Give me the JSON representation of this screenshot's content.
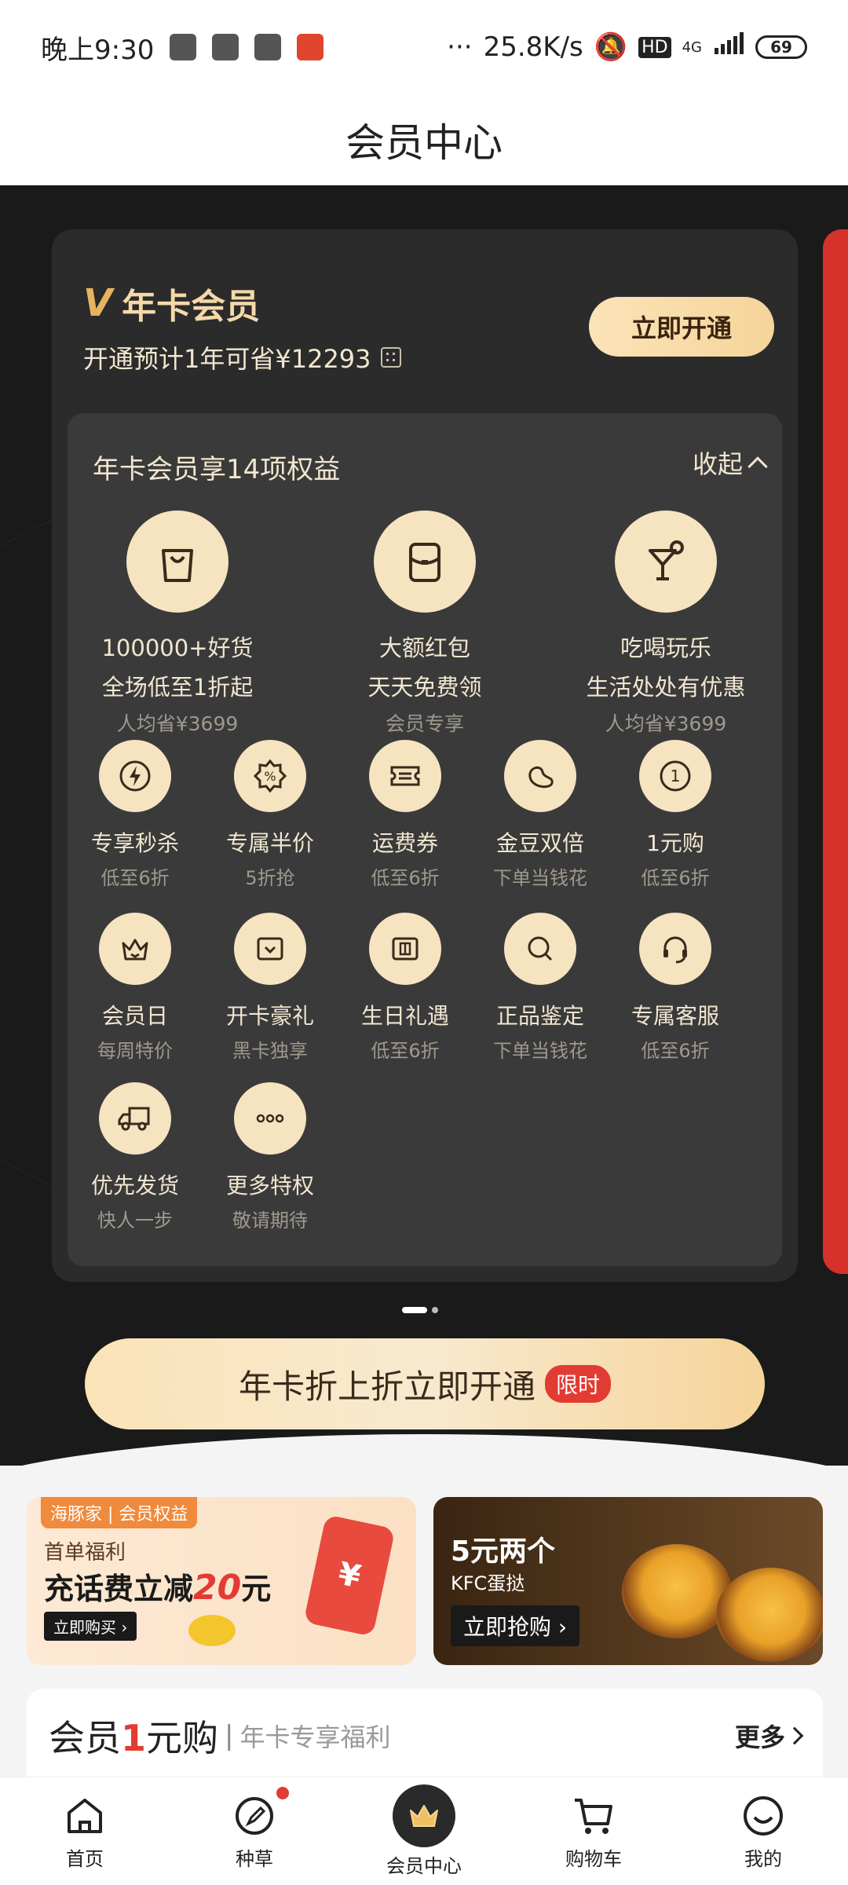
{
  "status_bar": {
    "time": "晚上9:30",
    "speed": "25.8K/s",
    "signal": "4G",
    "battery": "69"
  },
  "page_title": "会员中心",
  "card": {
    "title": "年卡会员",
    "subtitle": "开通预计1年可省¥12293",
    "open_button": "立即开通",
    "benefits_title": "年卡会员享14项权益",
    "collapse_label": "收起",
    "big_items": [
      {
        "l1": "100000+好货",
        "l2": "全场低至1折起",
        "l3": "人均省¥3699",
        "icon": "shopping-bag-icon"
      },
      {
        "l1": "大额红包",
        "l2": "天天免费领",
        "l3": "会员专享",
        "icon": "red-packet-icon"
      },
      {
        "l1": "吃喝玩乐",
        "l2": "生活处处有优惠",
        "l3": "人均省¥3699",
        "icon": "cocktail-icon"
      }
    ],
    "small_items": [
      {
        "l1": "专享秒杀",
        "l2": "低至6折",
        "icon": "lightning-icon"
      },
      {
        "l1": "专属半价",
        "l2": "5折抢",
        "icon": "discount-badge-icon"
      },
      {
        "l1": "运费券",
        "l2": "低至6折",
        "icon": "ticket-icon"
      },
      {
        "l1": "金豆双倍",
        "l2": "下单当钱花",
        "icon": "bean-icon"
      },
      {
        "l1": "1元购",
        "l2": "低至6折",
        "icon": "one-coin-icon"
      },
      {
        "l1": "会员日",
        "l2": "每周特价",
        "icon": "crown-icon"
      },
      {
        "l1": "开卡豪礼",
        "l2": "黑卡独享",
        "icon": "gift-screen-icon"
      },
      {
        "l1": "生日礼遇",
        "l2": "低至6折",
        "icon": "birthday-gift-icon"
      },
      {
        "l1": "正品鉴定",
        "l2": "下单当钱花",
        "icon": "magnifier-icon"
      },
      {
        "l1": "专属客服",
        "l2": "低至6折",
        "icon": "headset-icon"
      },
      {
        "l1": "优先发货",
        "l2": "快人一步",
        "icon": "truck-icon"
      },
      {
        "l1": "更多特权",
        "l2": "敬请期待",
        "icon": "more-dots-icon"
      }
    ]
  },
  "main_button": {
    "label": "年卡折上折立即开通",
    "tag": "限时"
  },
  "banner_a": {
    "tag": "海豚家 | 会员权益",
    "line1": "首单福利",
    "line2_prefix": "充话费立减",
    "line2_num": "20",
    "line2_suffix": "元",
    "button": "立即购买 ›",
    "phone_symbol": "¥"
  },
  "banner_b": {
    "line1": "5元两个",
    "line2": "KFC蛋挞",
    "button": "立即抢购 ›"
  },
  "section": {
    "title_prefix": "会员",
    "title_num": "1",
    "title_suffix": "元购",
    "subtitle": "年卡专享福利",
    "more": "更多"
  },
  "tabs": [
    {
      "label": "首页",
      "icon": "home-icon"
    },
    {
      "label": "种草",
      "icon": "compass-icon"
    },
    {
      "label": "会员中心",
      "icon": "crown-icon"
    },
    {
      "label": "购物车",
      "icon": "cart-icon"
    },
    {
      "label": "我的",
      "icon": "smile-icon"
    }
  ]
}
